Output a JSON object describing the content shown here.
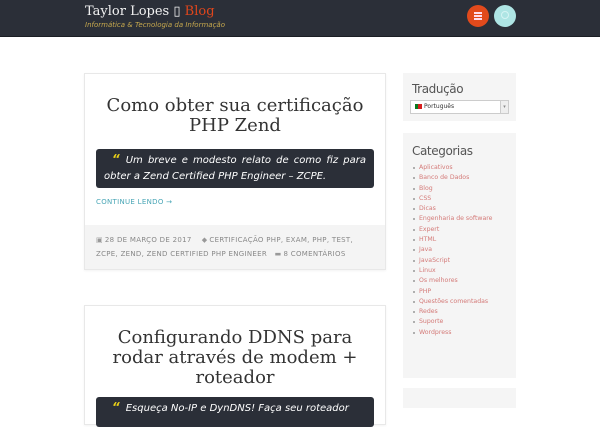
{
  "header": {
    "title": "Taylor Lopes",
    "title_separator": "▯",
    "title_accent": "Blog",
    "tagline": "Informática & Tecnologia da Informação"
  },
  "posts": [
    {
      "title": "Como obter sua certificação PHP Zend",
      "excerpt": "Um breve e modesto relato de como fiz para obter a Zend Certified PHP Engineer – ZCPE.",
      "more": "CONTINUE LENDO →",
      "date": "28 DE MARÇO DE 2017",
      "tags": "CERTIFICAÇÃO PHP, EXAM, PHP, TEST, ZCPE, ZEND, ZEND CERTIFIED PHP ENGINEER",
      "comments": "8 COMENTÁRIOS"
    },
    {
      "title": "Configurando DDNS para rodar através de modem + roteador",
      "excerpt": "Esqueça No-IP e DynDNS! Faça seu roteador"
    }
  ],
  "sidebar": {
    "translation": {
      "title": "Tradução",
      "selected": "Português"
    },
    "categories": {
      "title": "Categorias",
      "items": [
        "Aplicativos",
        "Banco de Dados",
        "Blog",
        "CSS",
        "Dicas",
        "Engenharia de software",
        "Expert",
        "HTML",
        "Java",
        "JavaScript",
        "Linux",
        "Os melhores",
        "PHP",
        "Questões comentadas",
        "Redes",
        "Suporte",
        "Wordpress"
      ]
    }
  },
  "colors": {
    "header_bg": "#2b2f38",
    "accent": "#e24a1c",
    "link": "#49a6b6",
    "category_link": "#d47a78"
  }
}
